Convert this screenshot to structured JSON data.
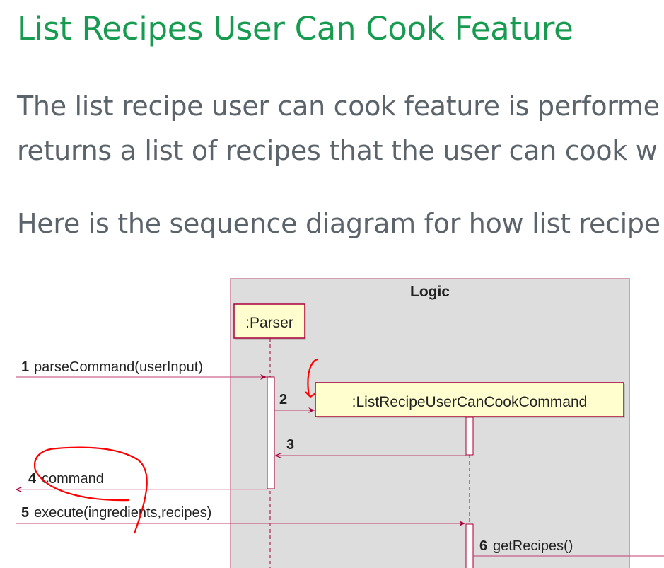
{
  "heading": "List Recipes User Can Cook Feature",
  "paragraphs": {
    "p1_line1": "The list recipe user can cook feature is performe",
    "p1_line2": "returns a list of recipes that the user can cook w",
    "p2": "Here is the sequence diagram for how list recipe"
  },
  "diagram": {
    "frame_label": "Logic",
    "participants": [
      ":Parser",
      ":ListRecipeUserCanCookCommand"
    ],
    "messages": [
      {
        "num": "1",
        "label": "parseCommand(userInput)"
      },
      {
        "num": "2",
        "label": ""
      },
      {
        "num": "3",
        "label": ""
      },
      {
        "num": "4",
        "label": "command"
      },
      {
        "num": "5",
        "label": "execute(ingredients,recipes)"
      },
      {
        "num": "6",
        "label": "getRecipes()"
      }
    ],
    "colors": {
      "line": "#a80036",
      "box_fill": "#fefece",
      "frame_fill": "#dddddd",
      "annotation": "#ff0000"
    }
  }
}
